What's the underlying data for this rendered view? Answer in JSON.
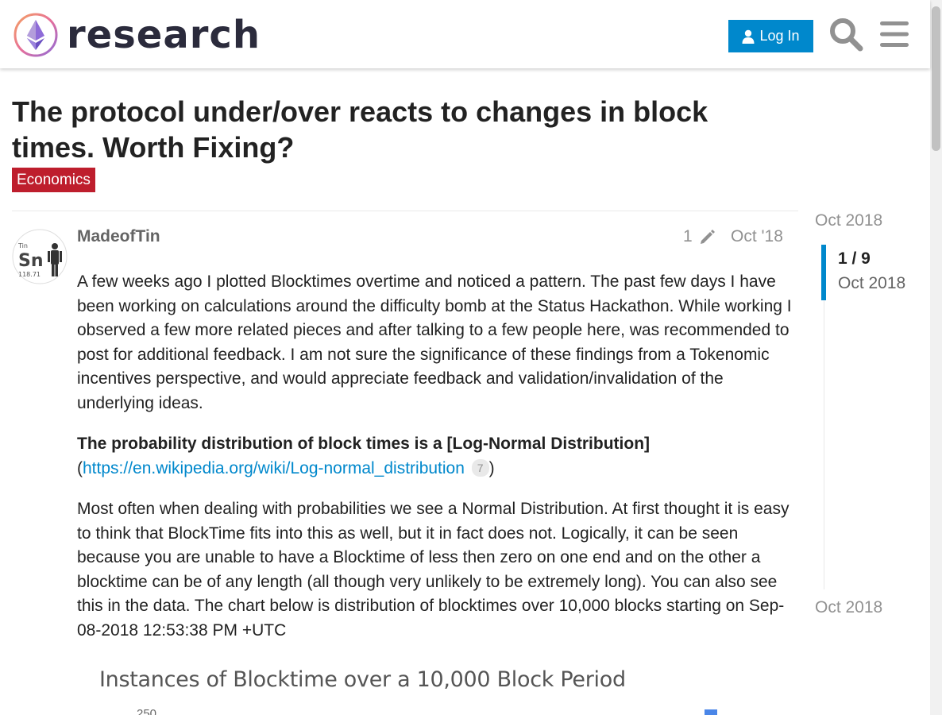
{
  "header": {
    "logo_text": "research",
    "login_label": "Log In"
  },
  "topic": {
    "title": "The protocol under/over reacts to changes in block times. Worth Fixing?",
    "category": "Economics",
    "category_color": "#be1e2d"
  },
  "post": {
    "username": "MadeofTin",
    "edit_count": "1",
    "date": "Oct '18",
    "avatar_symbol": "Sn",
    "avatar_number": "118.71",
    "avatar_small": "Tin",
    "paragraph1": "A few weeks ago I plotted Blocktimes overtime and noticed a pattern. The past few days I have been working on calculations around the difficulty bomb at the Status Hackathon. While working I observed a few more related pieces and after talking to a few people here, was recommended to post for additional feedback. I am not sure the significance of these findings from a Tokenomic incentives perspective, and would appreciate feedback and validation/invalidation of the underlying ideas.",
    "heading_bold": "The probability distribution of block times is a [Log-Normal Distribution]",
    "open_paren": "(",
    "link_text": "https://en.wikipedia.org/wiki/Log-normal_distribution",
    "link_clicks": "7",
    "close_paren": ")",
    "paragraph3": "Most often when dealing with probabilities we see a Normal Distribution. At first thought it is easy to think that BlockTime fits into this as well, but it in fact does not. Logically, it can be seen because you are unable to have a Blocktime of less then zero on one end and on the other a blocktime can be of any length (all though very unlikely to be extremely long). You can also see this in the data. The chart below is distribution of blocktimes over 10,000 blocks starting on Sep-08-2018 12:53:38 PM +UTC",
    "chart_title": "Instances of Blocktime over a 10,000 Block Period",
    "chart_tick": "250"
  },
  "timeline": {
    "start": "Oct 2018",
    "position": "1 / 9",
    "position_date": "Oct 2018",
    "end": "Oct 2018"
  },
  "colors": {
    "accent": "#0088cc",
    "category": "#be1e2d"
  }
}
